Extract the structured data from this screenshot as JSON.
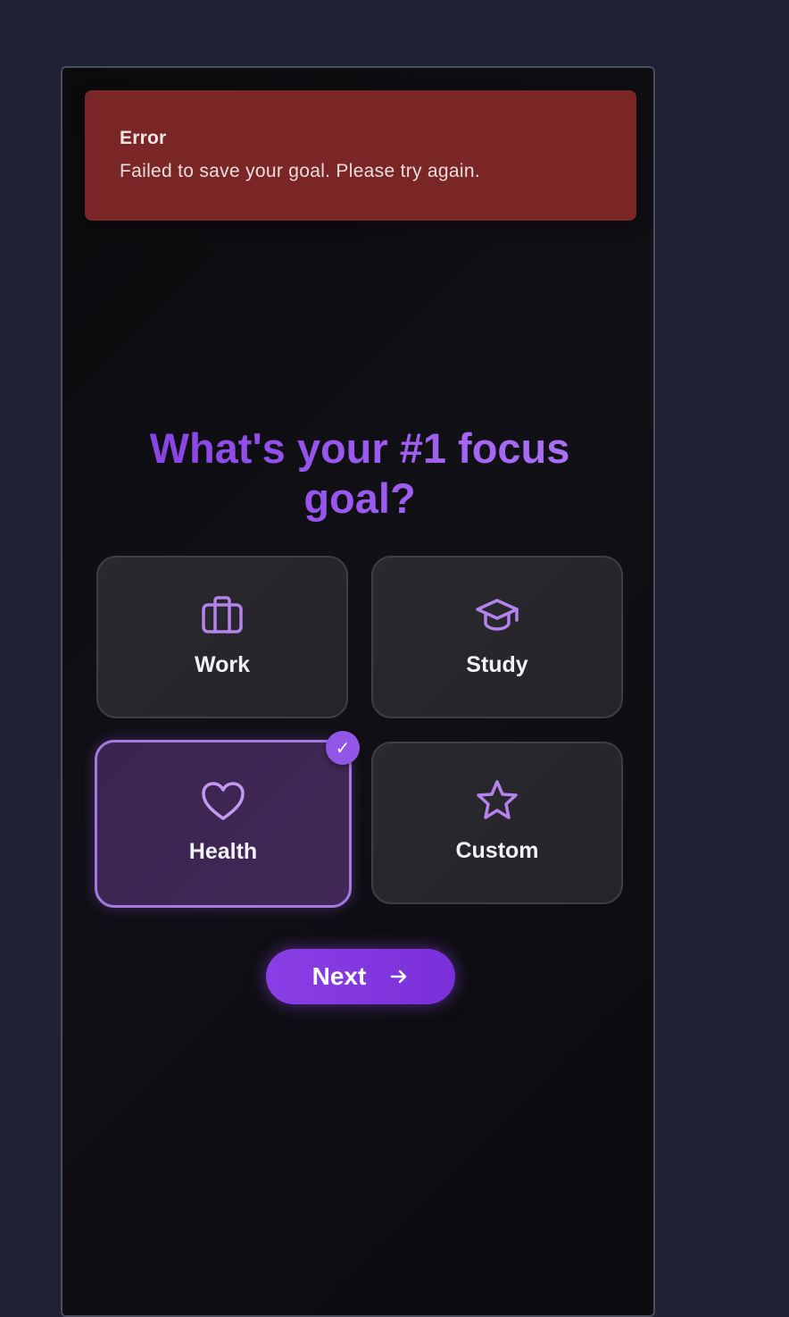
{
  "error_toast": {
    "title": "Error",
    "message": "Failed to save your goal. Please try again."
  },
  "question": {
    "line1": "What's your #1 focus",
    "line2": "goal?"
  },
  "options": [
    {
      "label": "Work",
      "icon": "briefcase-icon",
      "selected": false
    },
    {
      "label": "Study",
      "icon": "graduation-cap-icon",
      "selected": false
    },
    {
      "label": "Health",
      "icon": "heart-icon",
      "selected": true
    },
    {
      "label": "Custom",
      "icon": "star-icon",
      "selected": false
    }
  ],
  "selected_indicator": "✓",
  "next_button": {
    "label": "Next",
    "icon": "arrow-right-icon"
  },
  "colors": {
    "background": "#1e2232",
    "error": "#7a2626",
    "accent": "#8a3ee6",
    "icon": "#b583ec",
    "card": "#2a292e",
    "selected_card": "#3a2550"
  }
}
